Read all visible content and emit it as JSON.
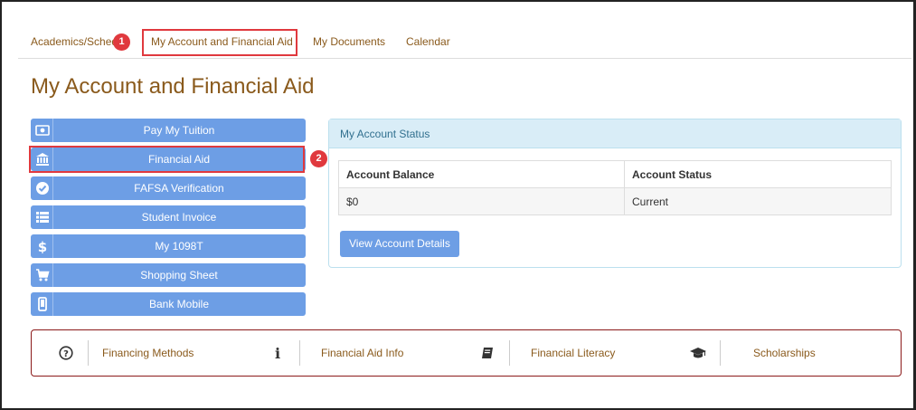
{
  "tabs": [
    {
      "label": "Academics/Sched"
    },
    {
      "label": "My Account and Financial Aid"
    },
    {
      "label": "My Documents"
    },
    {
      "label": "Calendar"
    }
  ],
  "annotations": {
    "badge1": "1",
    "badge2": "2",
    "highlight_color": "#e0393e"
  },
  "page": {
    "title": "My Account and Financial Aid"
  },
  "menu": {
    "items": [
      {
        "label": "Pay My Tuition",
        "icon": "money-icon"
      },
      {
        "label": "Financial Aid",
        "icon": "bank-icon"
      },
      {
        "label": "FAFSA Verification",
        "icon": "check-circle-icon"
      },
      {
        "label": "Student Invoice",
        "icon": "list-icon"
      },
      {
        "label": "My 1098T",
        "icon": "dollar-icon"
      },
      {
        "label": "Shopping Sheet",
        "icon": "cart-icon"
      },
      {
        "label": "Bank Mobile",
        "icon": "mobile-icon"
      }
    ]
  },
  "account_status": {
    "title": "My Account Status",
    "columns": [
      "Account Balance",
      "Account Status"
    ],
    "rows": [
      [
        "$0",
        "Current"
      ]
    ],
    "button": "View Account Details"
  },
  "bottom_links": [
    {
      "label": "Financing Methods",
      "icon": "question-circle-icon"
    },
    {
      "label": "Financial Aid Info",
      "icon": "info-icon"
    },
    {
      "label": "Financial Literacy",
      "icon": "book-icon"
    },
    {
      "label": "Scholarships",
      "icon": "graduation-cap-icon"
    }
  ],
  "colors": {
    "accent": "#6d9ee5",
    "link": "#8a5a1c",
    "border_bottom": "#8b1a1a"
  }
}
